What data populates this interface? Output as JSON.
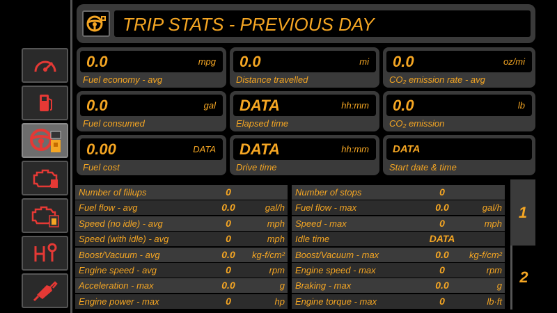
{
  "header": {
    "title": "TRIP STATS - PREVIOUS DAY",
    "icon": "steering-wheel-fuel-icon"
  },
  "nav": [
    {
      "icon": "gauge-icon",
      "active": false
    },
    {
      "icon": "fuel-pump-icon",
      "active": false
    },
    {
      "icon": "steering-wheel-fuel-icon",
      "active": true
    },
    {
      "icon": "engine-icon",
      "active": false
    },
    {
      "icon": "engine-fuel-icon",
      "active": false
    },
    {
      "icon": "gear-shift-icon",
      "active": false
    },
    {
      "icon": "fuel-nozzle-icon",
      "active": false
    }
  ],
  "tiles": [
    {
      "value": "0.0",
      "unit": "mpg",
      "label": "Fuel economy - avg"
    },
    {
      "value": "0.0",
      "unit": "mi",
      "label": "Distance travelled"
    },
    {
      "value": "0.0",
      "unit": "oz/mi",
      "label": "CO₂  emission rate - avg"
    },
    {
      "value": "0.0",
      "unit": "gal",
      "label": "Fuel consumed"
    },
    {
      "value": "DATA",
      "unit": "hh:mm",
      "label": "Elapsed time"
    },
    {
      "value": "0.0",
      "unit": "lb",
      "label": "CO₂  emission"
    },
    {
      "value": "0.00",
      "unit": "DATA",
      "label": "Fuel cost"
    },
    {
      "value": "DATA",
      "unit": "hh:mm",
      "label": "Drive time"
    },
    {
      "value": "DATA",
      "unit": "",
      "label": "Start date & time"
    }
  ],
  "table_left": [
    {
      "label": "Number of fillups",
      "value": "0",
      "unit": ""
    },
    {
      "label": "Fuel flow - avg",
      "value": "0.0",
      "unit": "gal/h"
    },
    {
      "label": "Speed (no idle) - avg",
      "value": "0",
      "unit": "mph"
    },
    {
      "label": "Speed (with idle) - avg",
      "value": "0",
      "unit": "mph"
    },
    {
      "label": "Boost/Vacuum - avg",
      "value": "0.0",
      "unit": "kg-f/cm²"
    },
    {
      "label": "Engine speed - avg",
      "value": "0",
      "unit": "rpm"
    },
    {
      "label": "Acceleration - max",
      "value": "0.0",
      "unit": "g"
    },
    {
      "label": "Engine power - max",
      "value": "0",
      "unit": "hp"
    }
  ],
  "table_right": [
    {
      "label": "Number of stops",
      "value": "0",
      "unit": ""
    },
    {
      "label": "Fuel flow - max",
      "value": "0.0",
      "unit": "gal/h"
    },
    {
      "label": "Speed - max",
      "value": "0",
      "unit": "mph"
    },
    {
      "label": "Idle time",
      "value": "DATA",
      "unit": ""
    },
    {
      "label": "Boost/Vacuum - max",
      "value": "0.0",
      "unit": "kg-f/cm²"
    },
    {
      "label": "Engine speed - max",
      "value": "0",
      "unit": "rpm"
    },
    {
      "label": "Braking - max",
      "value": "0.0",
      "unit": "g"
    },
    {
      "label": "Engine torque - max",
      "value": "0",
      "unit": "lb·ft"
    }
  ],
  "pages": [
    {
      "label": "1",
      "active": true
    },
    {
      "label": "2",
      "active": false
    }
  ],
  "colors": {
    "accent": "#f5a623",
    "icon_red": "#e53935",
    "panel": "#3a3a3a"
  }
}
